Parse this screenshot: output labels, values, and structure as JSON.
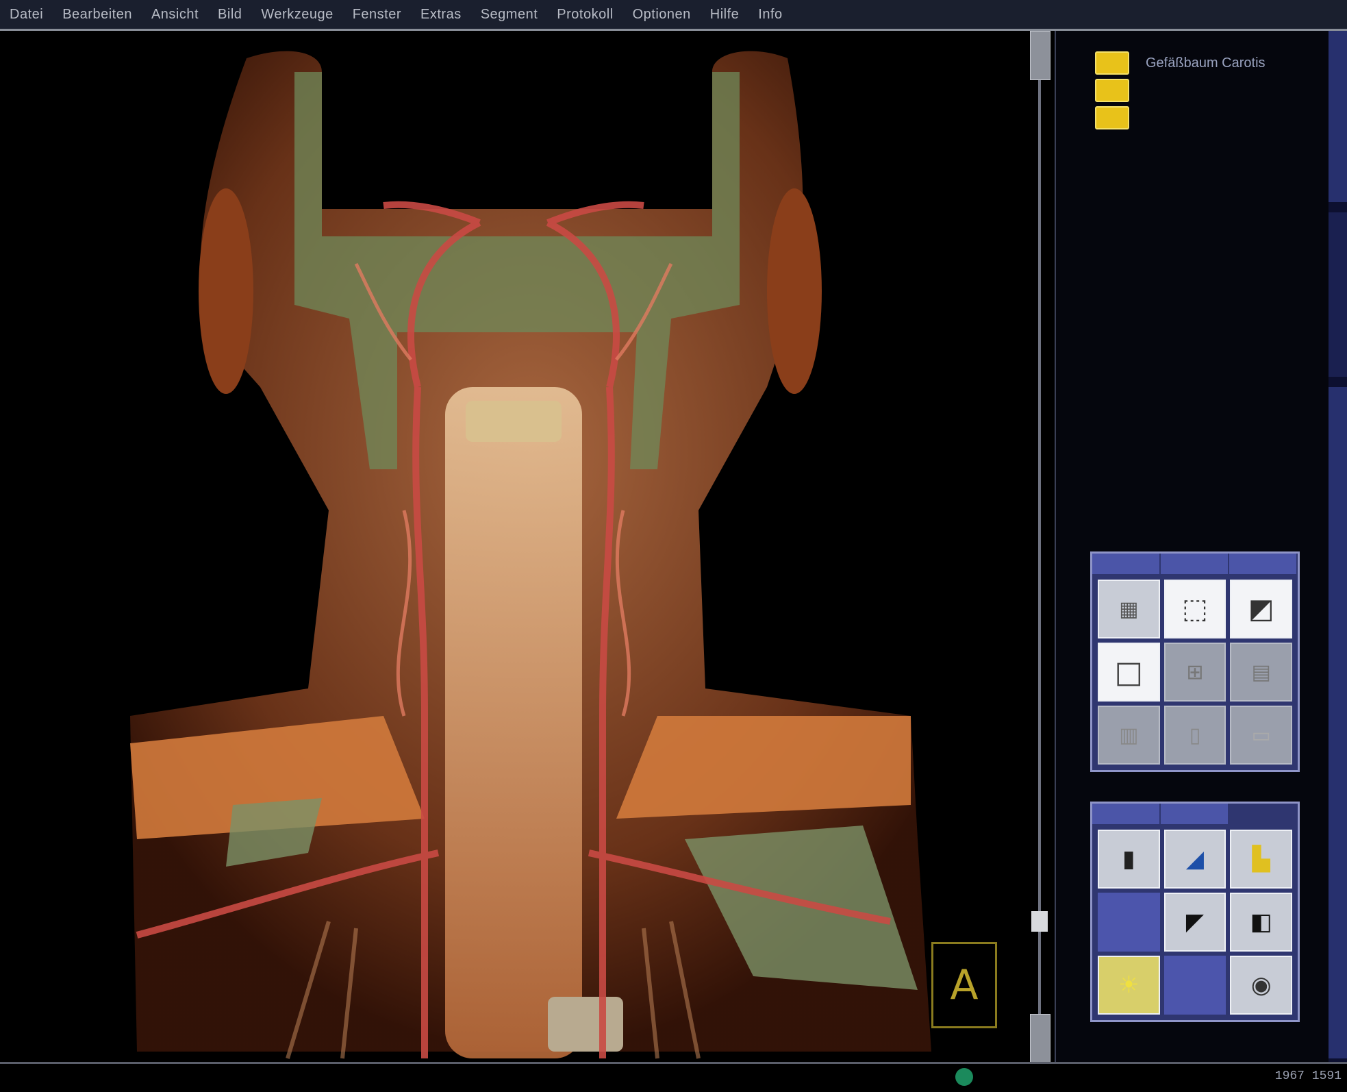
{
  "menubar": {
    "items": [
      "Datei",
      "Bearbeiten",
      "Ansicht",
      "Bild",
      "Werkzeuge",
      "Fenster",
      "Extras",
      "Segment",
      "Protokoll",
      "Optionen",
      "Hilfe",
      "Info"
    ]
  },
  "legend": {
    "items": [
      {
        "label": "Gefäßbaum Carotis",
        "color": "#e8c21a"
      },
      {
        "label": "",
        "color": "#e8c21a"
      },
      {
        "label": "",
        "color": "#e8c21a"
      }
    ]
  },
  "viewport": {
    "orientation_marker": "A",
    "background": "#000000"
  },
  "tool_panel_top": {
    "tabs": [
      "",
      "",
      ""
    ],
    "icons": [
      "render-mode-icon",
      "zoom-icon",
      "rotate-icon",
      "frame-icon",
      "pan-icon",
      "window-icon",
      "layout-icon",
      "measure-icon",
      "clip-icon"
    ]
  },
  "tool_panel_bottom": {
    "tabs": [
      "",
      ""
    ],
    "icons": [
      "ruler-icon",
      "segment-icon",
      "highlight-icon",
      "blank",
      "film-icon",
      "compare-icon",
      "light-icon",
      "blank",
      "camera-icon"
    ]
  },
  "edge_tabs": [
    "",
    "",
    ""
  ],
  "statusbar": {
    "text": "1967 1591"
  }
}
